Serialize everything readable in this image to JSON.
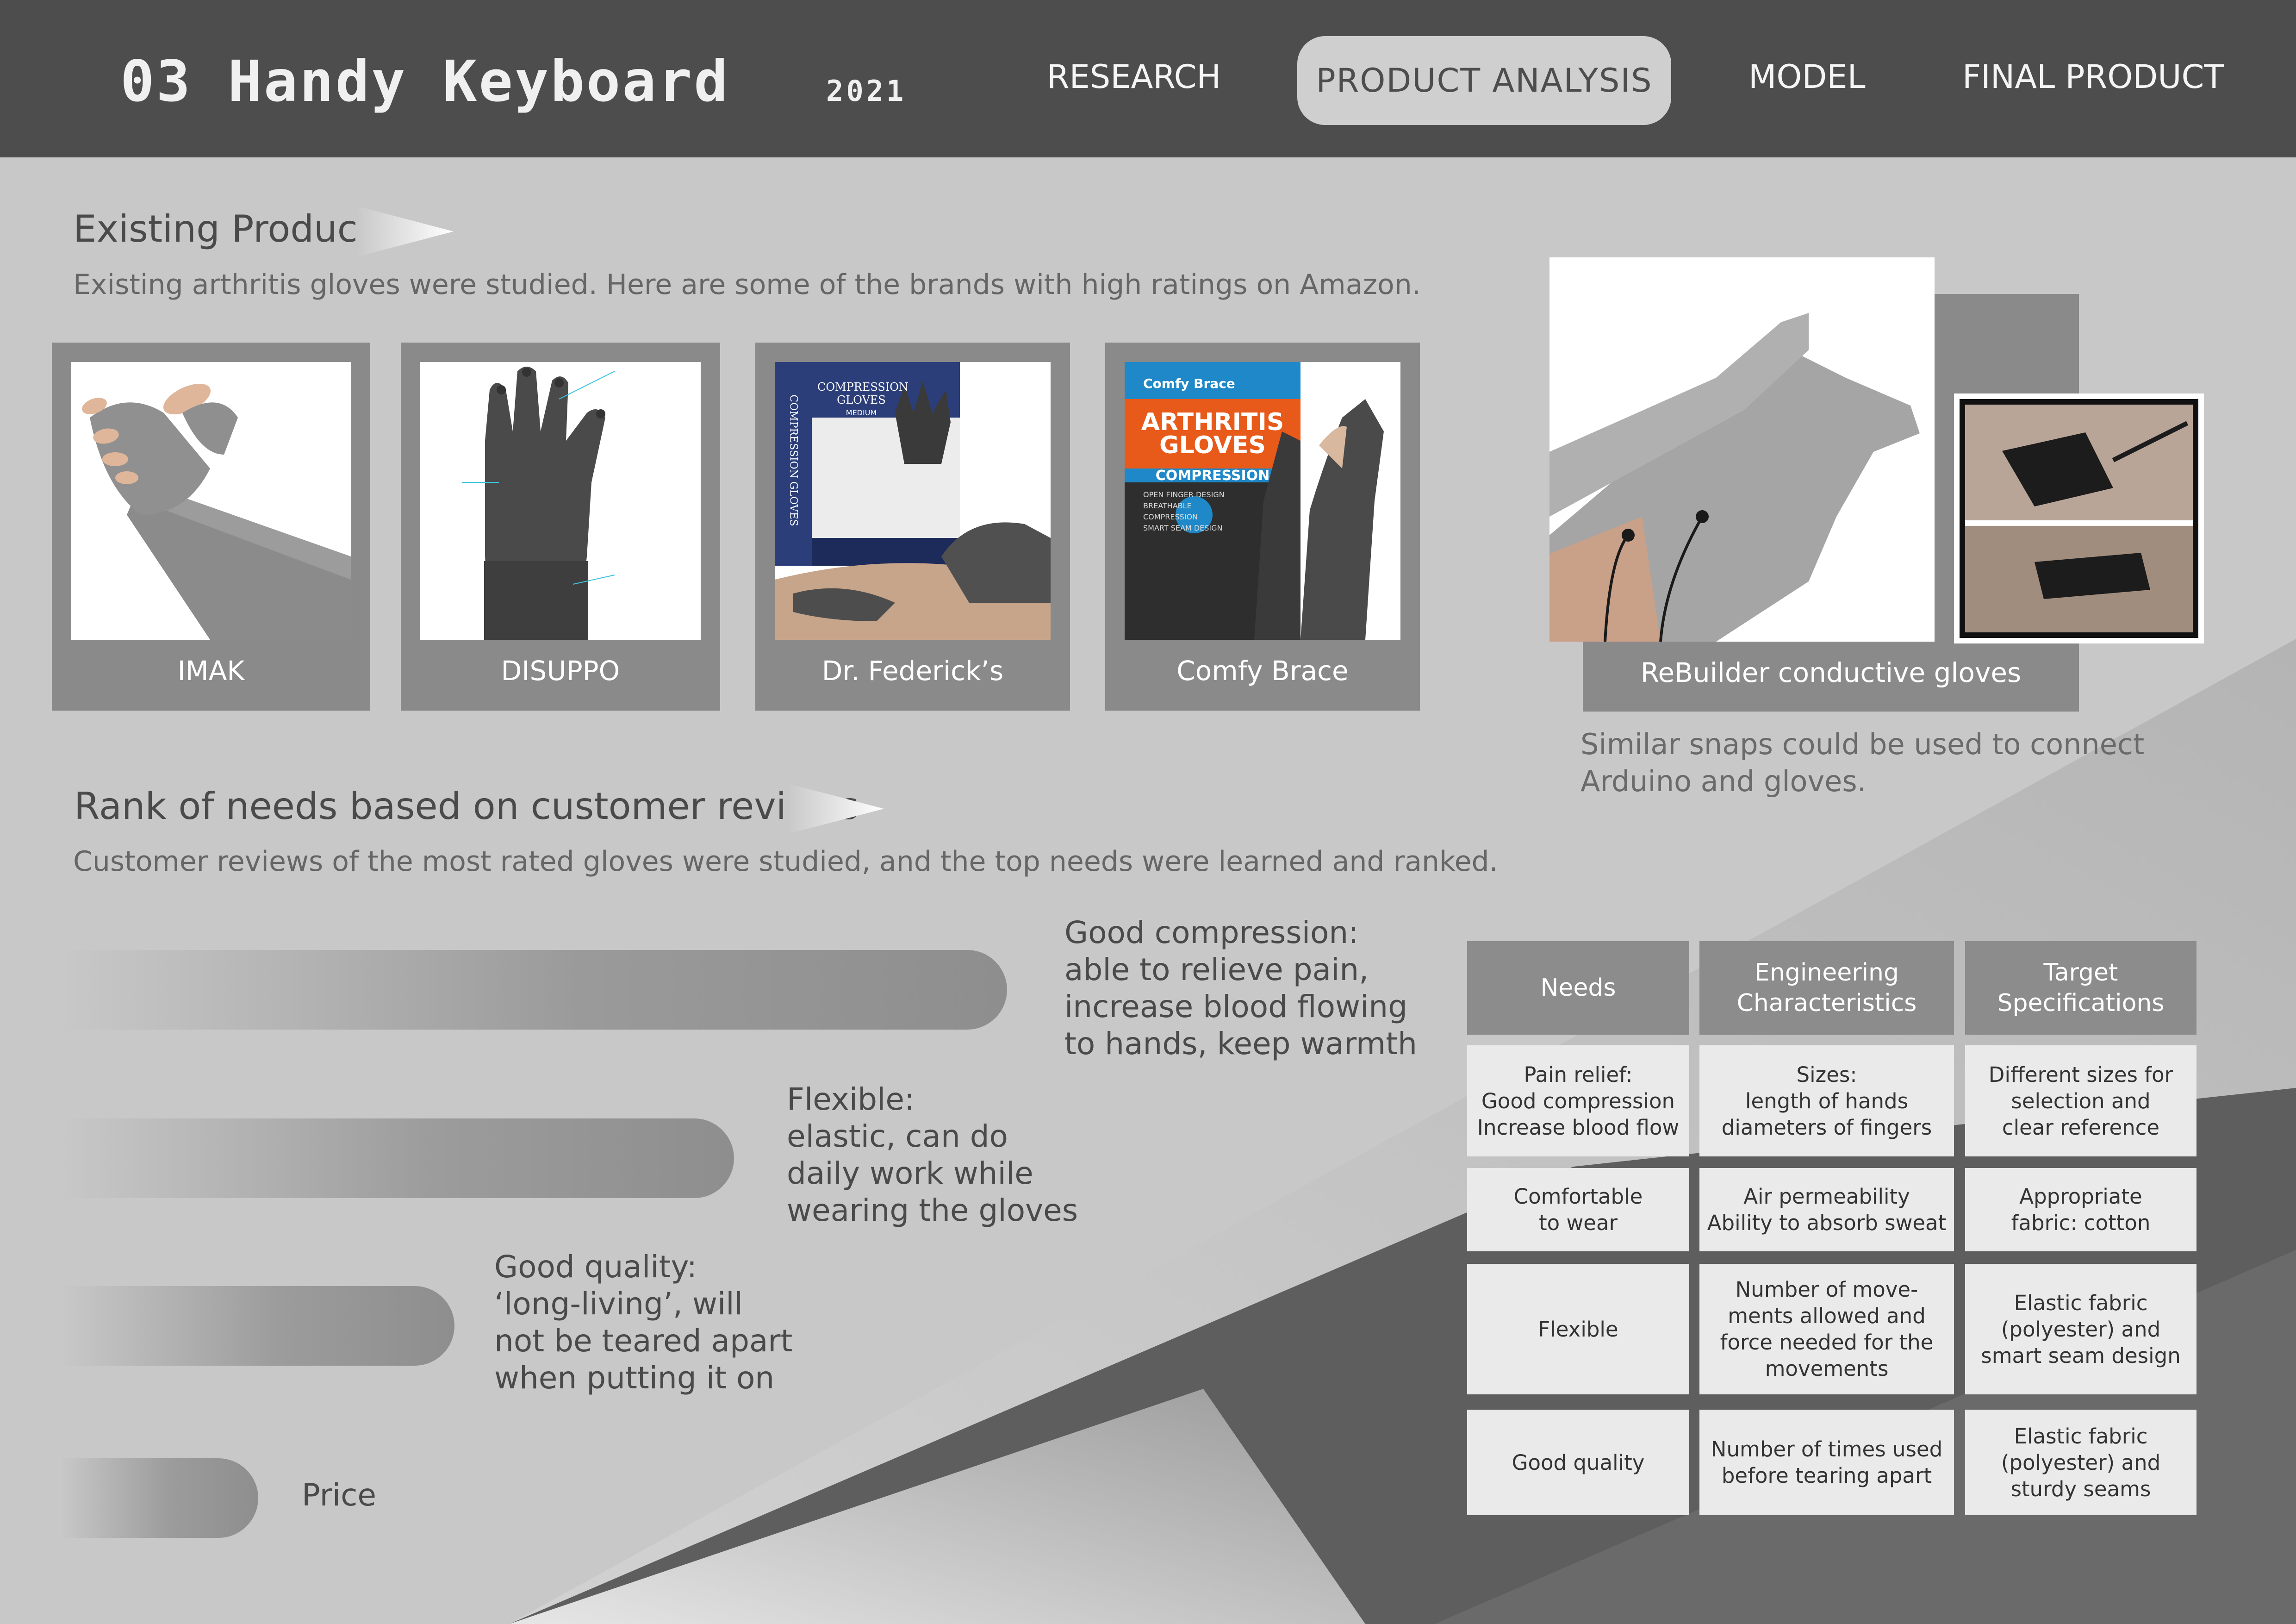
{
  "header": {
    "title": "03 Handy Keyboard",
    "year": "2021",
    "nav": {
      "research": "RESEARCH",
      "product_analysis": "PRODUCT ANALYSIS",
      "model": "MODEL",
      "final_product": "FINAL PRODUCT"
    }
  },
  "existing": {
    "heading": "Existing Product",
    "description": "Existing arthritis gloves were studied. Here are some of the brands with high ratings on Amazon.",
    "products": [
      {
        "label": "IMAK"
      },
      {
        "label": "DISUPPO"
      },
      {
        "label": "Dr. Federick’s"
      },
      {
        "label": "Comfy Brace"
      }
    ],
    "box_text": {
      "fed_box_title": "COMPRESSION GLOVES",
      "fed_box_sub": "MEDIUM",
      "fed_box_side": "COMPRESSION GLOVES",
      "comfy_logo": "Comfy Brace",
      "comfy_title": "ARTHRITIS GLOVES",
      "comfy_sub": "COMPRESSION",
      "comfy_features": "OPEN FINGER DESIGN\nBREATHABLE\nCOMPRESSION\nSMART SEAM DESIGN"
    }
  },
  "rebuilder": {
    "label": "ReBuilder conductive gloves",
    "note_line1": "Similar snaps could be used to connect",
    "note_line2": "Arduino and gloves."
  },
  "needs": {
    "heading": "Rank of needs based on customer  reviews",
    "description": "Customer reviews of the most rated gloves were studied, and the top needs were learned and ranked.",
    "items": [
      {
        "lines": [
          "Good compression:",
          "able to relieve pain,",
          "increase blood flowing",
          "to hands, keep warmth"
        ]
      },
      {
        "lines": [
          "Flexible:",
          "elastic, can do",
          "daily work while",
          "wearing the gloves"
        ]
      },
      {
        "lines": [
          "Good quality:",
          "‘long-living’, will",
          "not be teared apart",
          "when putting it on"
        ]
      },
      {
        "lines": [
          "Price"
        ]
      }
    ]
  },
  "table": {
    "headers": [
      [
        "Needs"
      ],
      [
        "Engineering",
        "Characteristics"
      ],
      [
        "Target",
        "Specifications"
      ]
    ],
    "rows": [
      [
        [
          "Pain relief:",
          "Good compression",
          "Increase blood flow"
        ],
        [
          "Sizes:",
          "length of hands",
          "diameters of fingers"
        ],
        [
          "Different sizes for",
          "selection and",
          "clear reference"
        ]
      ],
      [
        [
          "Comfortable",
          "to wear"
        ],
        [
          "Air permeability",
          "Ability to absorb sweat"
        ],
        [
          "Appropriate",
          "fabric: cotton"
        ]
      ],
      [
        [
          "Flexible"
        ],
        [
          "Number of move-",
          "ments allowed and",
          "force needed for the",
          "movements"
        ],
        [
          "Elastic fabric",
          "(polyester) and",
          "smart seam design"
        ]
      ],
      [
        [
          "Good quality"
        ],
        [
          "Number of times used",
          "before tearing apart"
        ],
        [
          "Elastic fabric",
          "(polyester) and",
          "sturdy seams"
        ]
      ]
    ]
  },
  "colors": {
    "header_bg": "#4d4d4d",
    "page_bg": "#c8c8c8",
    "card_bg": "#8a8a8a",
    "table_head": "#8c8c8c",
    "table_cell": "#eaeaea",
    "bar_end": "#8e8e8e"
  },
  "icons": [
    "arrow-triangle-icon"
  ]
}
